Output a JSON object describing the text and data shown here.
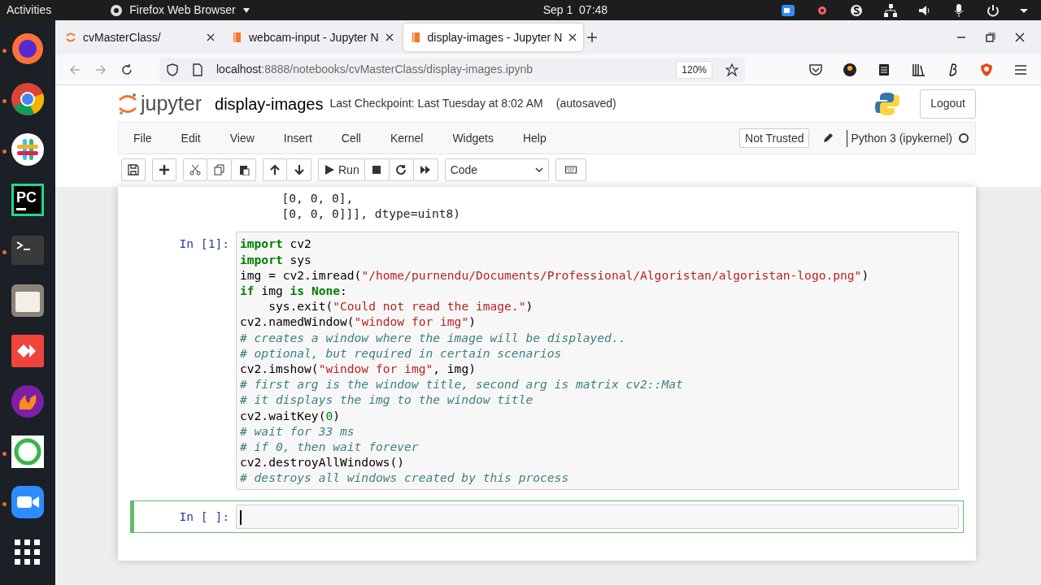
{
  "top_bar": {
    "activities": "Activities",
    "app_menu": "Firefox Web Browser",
    "clock": "Sep 1  07:48"
  },
  "dock": [
    {
      "kind": "firefox",
      "running": true
    },
    {
      "kind": "chrome",
      "running": true
    },
    {
      "kind": "slack",
      "running": true
    },
    {
      "kind": "pycharm",
      "label": "PC",
      "running": false
    },
    {
      "kind": "terminal",
      "running": true
    },
    {
      "kind": "files",
      "running": false
    },
    {
      "kind": "anydesk",
      "running": false
    },
    {
      "kind": "flame",
      "running": false
    },
    {
      "kind": "ring",
      "running": true
    },
    {
      "kind": "zoom",
      "running": true
    },
    {
      "kind": "grid",
      "running": false
    }
  ],
  "tabs": [
    {
      "title": "cvMasterClass/",
      "kind": "jupyter",
      "selected": false
    },
    {
      "title": "webcam-input - Jupyter N",
      "kind": "notebook",
      "selected": false
    },
    {
      "title": "display-images - Jupyter N",
      "kind": "notebook",
      "selected": true
    }
  ],
  "url": {
    "host": "localhost",
    "path": ":8888/notebooks/cvMasterClass/display-images.ipynb"
  },
  "zoom": "120%",
  "jupyter": {
    "logo": "jupyter",
    "notebook_name": "display-images",
    "checkpoint": "Last Checkpoint: Last Tuesday at 8:02 AM",
    "autosave": "(autosaved)",
    "logout": "Logout"
  },
  "menu": [
    "File",
    "Edit",
    "View",
    "Insert",
    "Cell",
    "Kernel",
    "Widgets",
    "Help"
  ],
  "trust": "Not Trusted",
  "kernel": "Python 3 (ipykernel)",
  "kernel_busy": false,
  "toolbar": {
    "run": "Run",
    "cell_type": "Code"
  },
  "output_lines": [
    "       [0, 0, 0],",
    "       [0, 0, 0]]], dtype=uint8)"
  ],
  "cells": [
    {
      "prompt": "In [1]:",
      "selected": false,
      "lines": [
        [
          {
            "kind": "kw",
            "text": "import"
          },
          {
            "kind": "plain",
            "text": " cv2"
          }
        ],
        [
          {
            "kind": "kw",
            "text": "import"
          },
          {
            "kind": "plain",
            "text": " sys"
          }
        ],
        [
          {
            "kind": "plain",
            "text": "img = cv2.imread("
          },
          {
            "kind": "str",
            "text": "\"/home/purnendu/Documents/Professional/Algoristan/algoristan-logo.png\""
          },
          {
            "kind": "plain",
            "text": ")"
          }
        ],
        [
          {
            "kind": "kw",
            "text": "if"
          },
          {
            "kind": "plain",
            "text": " img "
          },
          {
            "kind": "kw",
            "text": "is"
          },
          {
            "kind": "kw",
            "text": " None"
          },
          {
            "kind": "plain",
            "text": ":"
          }
        ],
        [
          {
            "kind": "plain",
            "text": "    sys.exit("
          },
          {
            "kind": "str",
            "text": "\"Could not read the image.\""
          },
          {
            "kind": "plain",
            "text": ")"
          }
        ],
        [
          {
            "kind": "plain",
            "text": "cv2.namedWindow("
          },
          {
            "kind": "str",
            "text": "\"window for img\""
          },
          {
            "kind": "plain",
            "text": ")"
          }
        ],
        [
          {
            "kind": "comment",
            "text": "# creates a window where the image will be displayed.."
          }
        ],
        [
          {
            "kind": "comment",
            "text": "# optional, but required in certain scenarios"
          }
        ],
        [
          {
            "kind": "plain",
            "text": "cv2.imshow("
          },
          {
            "kind": "str",
            "text": "\"window for img\""
          },
          {
            "kind": "plain",
            "text": ", img)"
          }
        ],
        [
          {
            "kind": "comment",
            "text": "# first arg is the window title, second arg is matrix cv2::Mat"
          }
        ],
        [
          {
            "kind": "comment",
            "text": "# it displays the img to the window title"
          }
        ],
        [
          {
            "kind": "plain",
            "text": "cv2.waitKey("
          },
          {
            "kind": "num",
            "text": "0"
          },
          {
            "kind": "plain",
            "text": ")"
          }
        ],
        [
          {
            "kind": "comment",
            "text": "# wait for 33 ms"
          }
        ],
        [
          {
            "kind": "comment",
            "text": "# if 0, then wait forever"
          }
        ],
        [
          {
            "kind": "plain",
            "text": "cv2.destroyAllWindows()"
          }
        ],
        [
          {
            "kind": "comment",
            "text": "# destroys all windows created by this process"
          }
        ]
      ]
    },
    {
      "prompt": "In [ ]:",
      "selected": true
    }
  ]
}
